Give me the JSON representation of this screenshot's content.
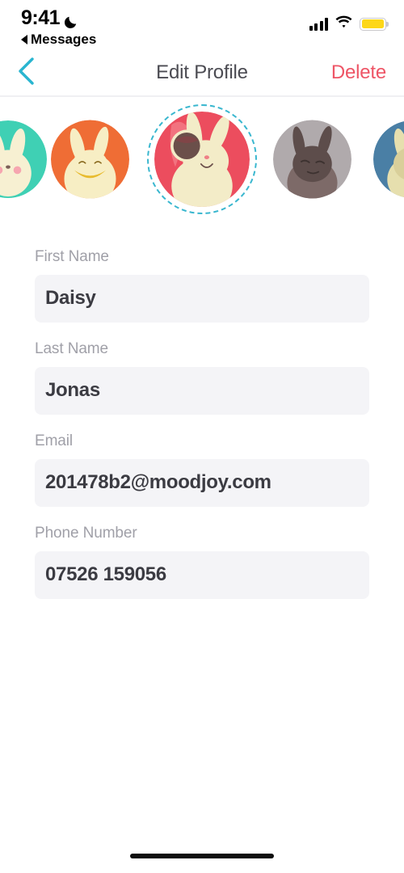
{
  "status_bar": {
    "time": "9:41",
    "dnd_icon": "moon-icon",
    "back_label": "Messages",
    "back_icon": "triangle-left-icon",
    "signal_icon": "cellular-signal-icon",
    "signal_bars": 4,
    "wifi_icon": "wifi-icon",
    "battery_icon": "battery-icon",
    "battery_level_percent": 100,
    "battery_color": "#fdd718"
  },
  "navbar": {
    "back_icon": "chevron-left-icon",
    "back_color": "#29b5d0",
    "title": "Edit Profile",
    "title_color": "#4b4b52",
    "delete_label": "Delete",
    "delete_color": "#ee5566"
  },
  "carousel": {
    "selected_index": 2,
    "selection_ring_color": "#3ab7cf",
    "avatars": [
      {
        "name": "avatar-teal-bunny",
        "bg": "#3fd0b4",
        "body": "#f7f0d2",
        "accent": "#f6a6b0",
        "dark": "#7c5f58",
        "partial": "left"
      },
      {
        "name": "avatar-orange-bunny",
        "bg": "#ef6d35",
        "body": "#f7eec4",
        "accent": "#e8bb2e",
        "dark": "#8a6b20",
        "partial": "none"
      },
      {
        "name": "avatar-red-bunny",
        "bg": "#ec4d5e",
        "body": "#f3ecc8",
        "accent": "#f08c95",
        "dark": "#6b4f4a",
        "partial": "none"
      },
      {
        "name": "avatar-gray-bunny",
        "bg": "#b0aaac",
        "body": "#5d4d4b",
        "accent": "#7d6a68",
        "dark": "#3d3230",
        "partial": "none"
      },
      {
        "name": "avatar-blue-bunny",
        "bg": "#4a7fa5",
        "body": "#e6dfae",
        "accent": "#d9cf9a",
        "dark": "#3a5f7d",
        "partial": "right"
      }
    ]
  },
  "form": {
    "fields": [
      {
        "name": "first-name",
        "label": "First Name",
        "value": "Daisy",
        "placeholder": "First Name"
      },
      {
        "name": "last-name",
        "label": "Last Name",
        "value": "Jonas",
        "placeholder": "Last Name"
      },
      {
        "name": "email",
        "label": "Email",
        "value": "201478b2@moodjoy.com",
        "placeholder": "Email"
      },
      {
        "name": "phone",
        "label": "Phone Number",
        "value": "07526 159056",
        "placeholder": "Phone Number"
      }
    ]
  },
  "home_indicator": {
    "name": "home-indicator"
  }
}
